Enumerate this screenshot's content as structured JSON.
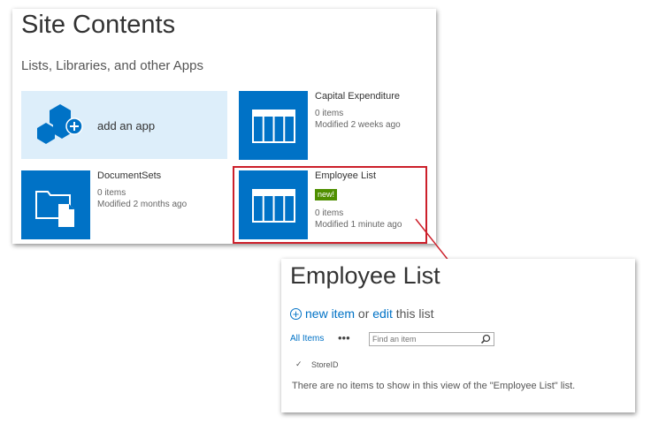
{
  "site_contents": {
    "title": "Site Contents",
    "subtitle": "Lists, Libraries, and other Apps",
    "add_app_label": "add an app",
    "tiles": [
      {
        "name": "Capital Expenditure",
        "items": "0 items",
        "modified": "Modified 2 weeks ago"
      },
      {
        "name": "DocumentSets",
        "items": "0 items",
        "modified": "Modified 2 months ago"
      },
      {
        "name": "Employee List",
        "badge": "new!",
        "items": "0 items",
        "modified": "Modified 1 minute ago"
      }
    ]
  },
  "employee_list": {
    "title": "Employee List",
    "new_item_link": "new item",
    "or_text": "or",
    "edit_link": "edit",
    "this_list_text": "this list",
    "all_items": "All Items",
    "more_label": "•••",
    "search_placeholder": "Find an item",
    "check_mark": "✓",
    "column_header": "StoreID",
    "empty_message": "There are no items to show in this view of the \"Employee List\" list."
  },
  "colors": {
    "tile_blue": "#0072c6",
    "add_app_bg": "#ddeefa",
    "highlight_red": "#cc1f2a",
    "badge_green": "#4f8f00"
  }
}
